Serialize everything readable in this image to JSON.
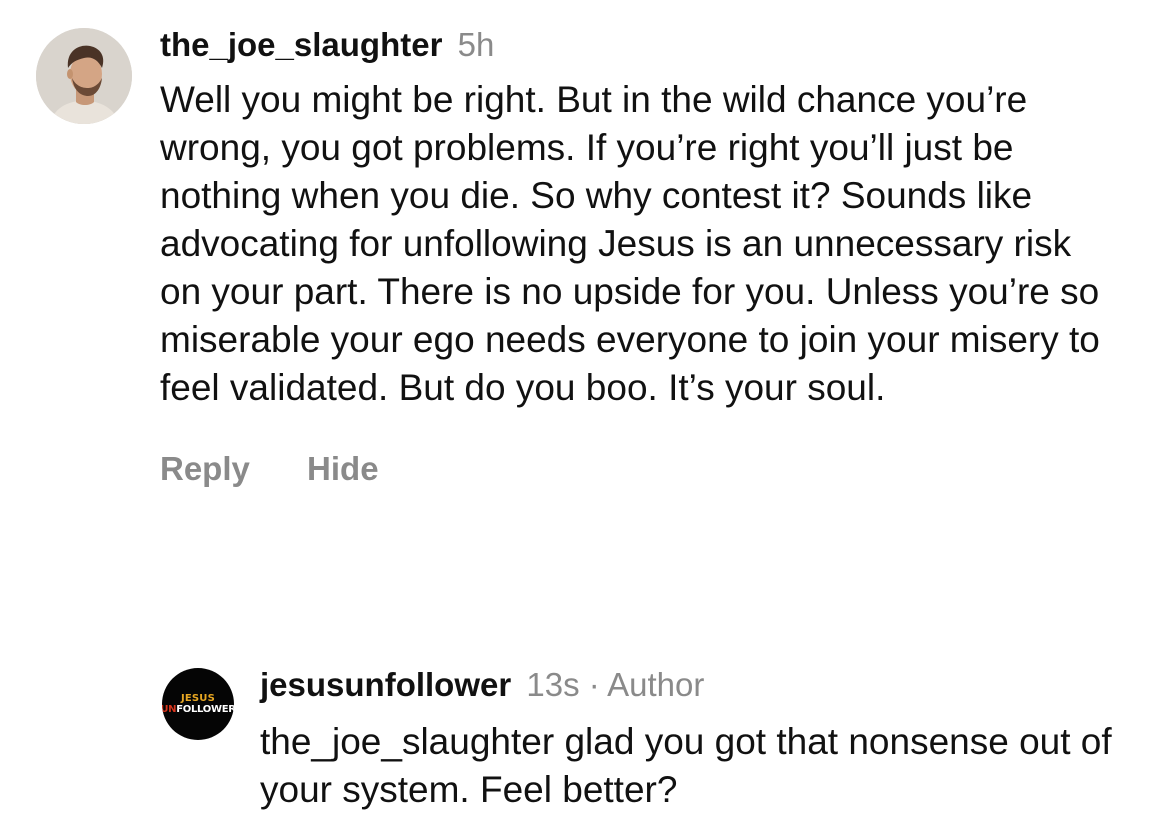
{
  "comment": {
    "avatar_icon": "profile-photo",
    "username": "the_joe_slaughter",
    "time": "5h",
    "text": "Well you might be right. But in the wild chance you’re wrong, you got problems. If you’re right you’ll just be nothing when you die. So why contest it? Sounds like advocating for unfollowing Jesus is an unnecessary risk on your part. There is no upside for you. Unless you’re so miserable your ego needs everyone to join your misery to feel validated. But do you boo. It’s your soul.",
    "actions": {
      "reply_label": "Reply",
      "hide_label": "Hide"
    }
  },
  "reply": {
    "avatar": {
      "logo_line1": "JESUS",
      "logo_line2_prefix": "UN",
      "logo_line2_rest": "FOLLOWER",
      "colors": {
        "background": "#050505",
        "line1": "#e8a722",
        "prefix": "#d6341d",
        "rest": "#ffffff"
      }
    },
    "username": "jesusunfollower",
    "time": "13s",
    "separator": "·",
    "author_tag": "Author",
    "text": "the_joe_slaughter glad you got that nonsense out of your system. Feel better?"
  },
  "colors": {
    "text": "#111111",
    "muted": "#8a8a8a",
    "background": "#ffffff"
  }
}
